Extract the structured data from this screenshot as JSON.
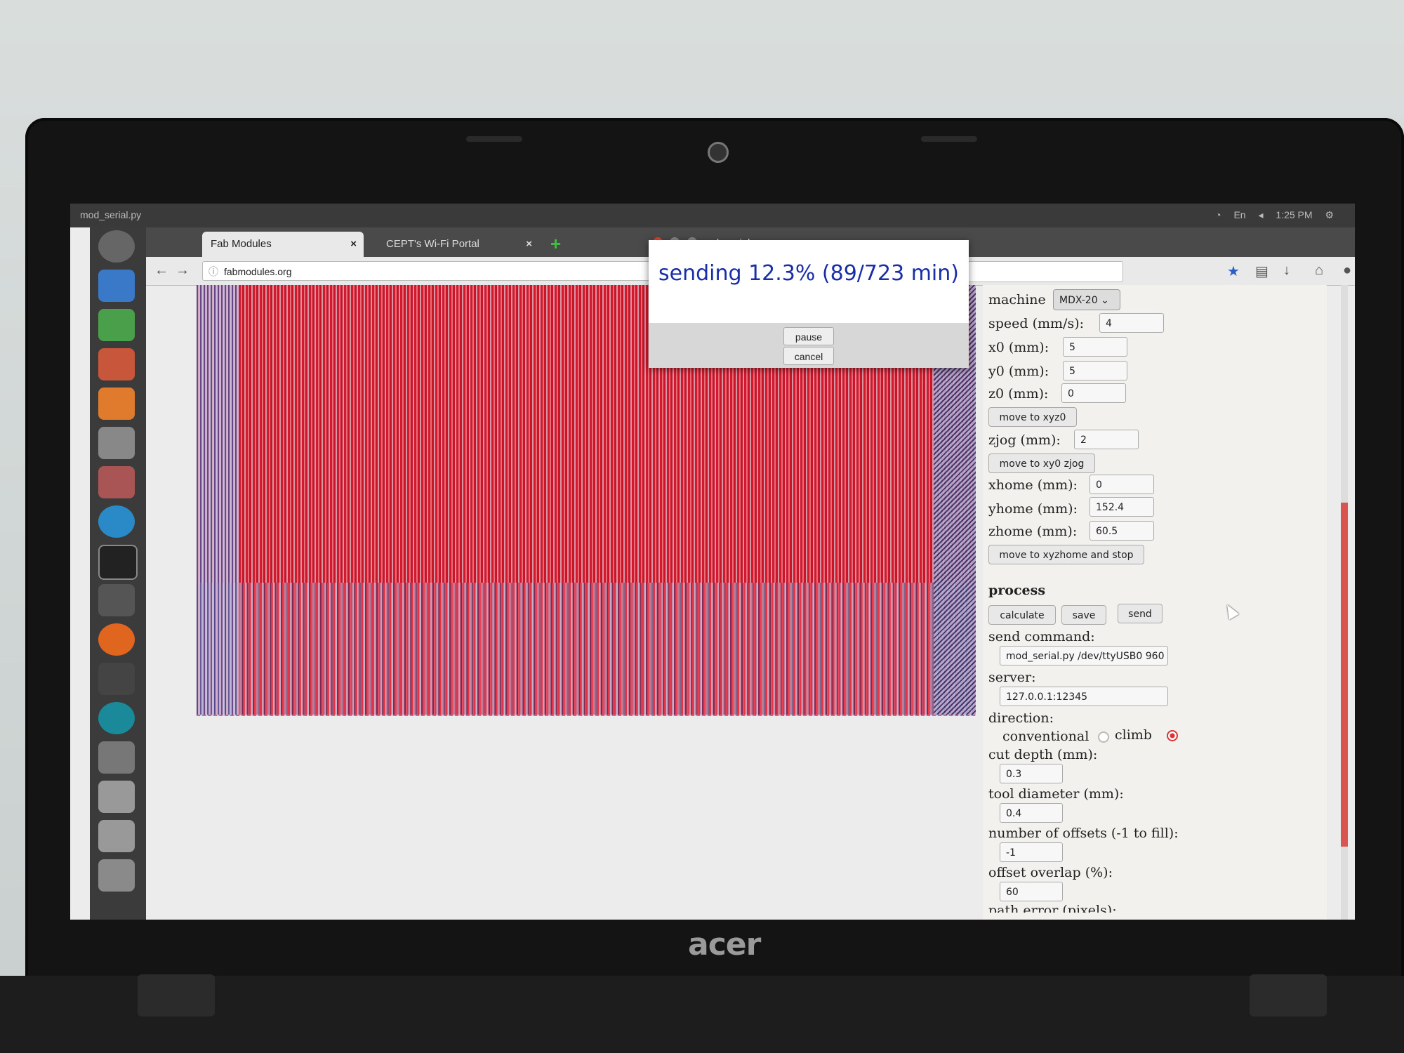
{
  "system": {
    "window_title": "mod_serial.py",
    "clock": "1:25 PM",
    "lang": "En"
  },
  "browser": {
    "tabs": [
      {
        "label": "Fab Modules"
      },
      {
        "label": "CEPT's Wi-Fi Portal"
      }
    ],
    "window_title": "mod_serial.py",
    "url": "fabmodules.org"
  },
  "panel": {
    "machine_label": "machine",
    "machine_value": "MDX-20",
    "speed_label": "speed (mm/s):",
    "speed_value": "4",
    "x0_label": "x0 (mm):",
    "x0_value": "5",
    "y0_label": "y0 (mm):",
    "y0_value": "5",
    "z0_label": "z0 (mm):",
    "z0_value": "0",
    "move_xyz0": "move to xyz0",
    "zjog_label": "zjog (mm):",
    "zjog_value": "2",
    "move_xy0_zjog": "move to xy0 zjog",
    "xhome_label": "xhome (mm):",
    "xhome_value": "0",
    "yhome_label": "yhome (mm):",
    "yhome_value": "152.4",
    "zhome_label": "zhome (mm):",
    "zhome_value": "60.5",
    "move_home": "move to xyzhome and stop",
    "process_heading": "process",
    "calculate": "calculate",
    "save": "save",
    "send": "send",
    "send_command_label": "send command:",
    "send_command_value": "mod_serial.py /dev/ttyUSB0 960",
    "server_label": "server:",
    "server_value": "127.0.0.1:12345",
    "direction_label": "direction:",
    "conventional": "conventional",
    "climb": "climb",
    "cut_depth_label": "cut depth (mm):",
    "cut_depth_value": "0.3",
    "tool_diameter_label": "tool diameter (mm):",
    "tool_diameter_value": "0.4",
    "offsets_label": "number of offsets (-1 to fill):",
    "offsets_value": "-1",
    "overlap_label": "offset overlap (%):",
    "overlap_value": "60",
    "path_error_label": "path error (pixels):"
  },
  "dialog": {
    "message": "sending 12.3% (89/723 min)",
    "progress_percent": 12.3,
    "pause": "pause",
    "cancel": "cancel"
  },
  "device": {
    "brand": "acer"
  },
  "colors": {
    "toolpath_red": "#c8243a",
    "toolpath_blue": "#3c3c78",
    "dialog_text": "#1a2da8",
    "radio_selected": "#dd3333"
  }
}
